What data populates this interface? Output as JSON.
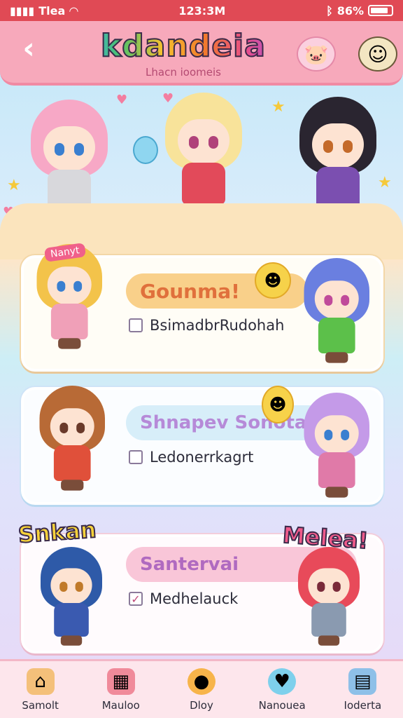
{
  "status_bar": {
    "carrier": "Tlea",
    "time": "123:3M",
    "battery": "86%"
  },
  "header": {
    "title": "kdandeia",
    "subtitle": "Lhacn ioomeis"
  },
  "cards": [
    {
      "title": "Gounma!",
      "item": "BsimadbrRudohah",
      "checked": false,
      "accent": "#f9d08a"
    },
    {
      "title": "Shnapev Sonota",
      "item": "Ledonerrkagrt",
      "checked": false,
      "accent": "#d7eef9"
    },
    {
      "title": "Santervai",
      "item": "Medhelauck",
      "checked": true,
      "accent": "#f9c6d8"
    }
  ],
  "tags": {
    "nametag": "Nanyt",
    "left_sticker": "Snkan",
    "right_sticker": "Melea!"
  },
  "nav": [
    {
      "label": "Samolt",
      "icon": "house-icon"
    },
    {
      "label": "Mauloo",
      "icon": "shop-icon"
    },
    {
      "label": "Dloy",
      "icon": "chat-bubble-icon"
    },
    {
      "label": "Nanouea",
      "icon": "heart-icon"
    },
    {
      "label": "Ioderta",
      "icon": "calendar-icon"
    }
  ],
  "colors": {
    "status_bar": "#e04a55",
    "header": "#f7a9bb",
    "nav_bg": "#fde6ec"
  }
}
